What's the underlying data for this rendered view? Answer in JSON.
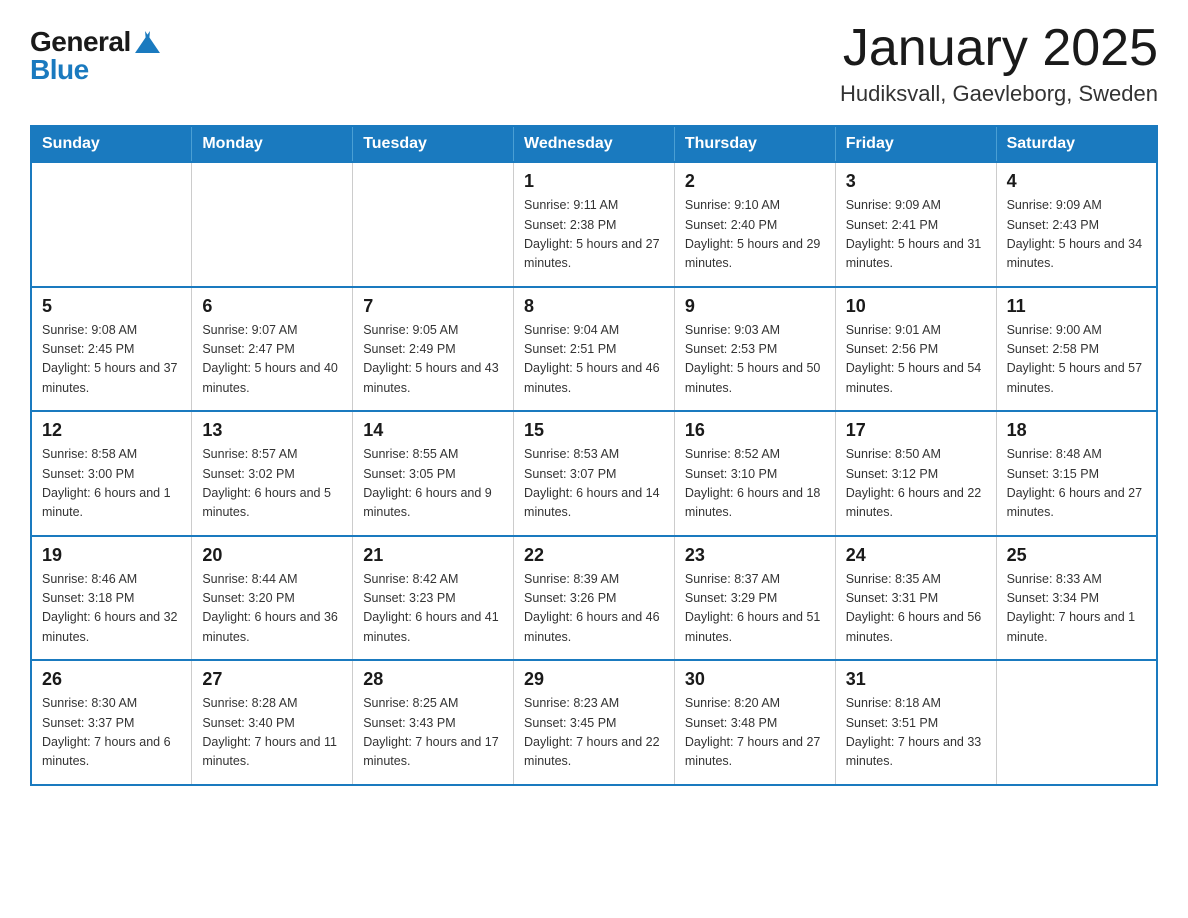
{
  "header": {
    "logo_general": "General",
    "logo_blue": "Blue",
    "month_title": "January 2025",
    "location": "Hudiksvall, Gaevleborg, Sweden"
  },
  "days_of_week": [
    "Sunday",
    "Monday",
    "Tuesday",
    "Wednesday",
    "Thursday",
    "Friday",
    "Saturday"
  ],
  "weeks": [
    [
      {
        "day": "",
        "detail": ""
      },
      {
        "day": "",
        "detail": ""
      },
      {
        "day": "",
        "detail": ""
      },
      {
        "day": "1",
        "detail": "Sunrise: 9:11 AM\nSunset: 2:38 PM\nDaylight: 5 hours\nand 27 minutes."
      },
      {
        "day": "2",
        "detail": "Sunrise: 9:10 AM\nSunset: 2:40 PM\nDaylight: 5 hours\nand 29 minutes."
      },
      {
        "day": "3",
        "detail": "Sunrise: 9:09 AM\nSunset: 2:41 PM\nDaylight: 5 hours\nand 31 minutes."
      },
      {
        "day": "4",
        "detail": "Sunrise: 9:09 AM\nSunset: 2:43 PM\nDaylight: 5 hours\nand 34 minutes."
      }
    ],
    [
      {
        "day": "5",
        "detail": "Sunrise: 9:08 AM\nSunset: 2:45 PM\nDaylight: 5 hours\nand 37 minutes."
      },
      {
        "day": "6",
        "detail": "Sunrise: 9:07 AM\nSunset: 2:47 PM\nDaylight: 5 hours\nand 40 minutes."
      },
      {
        "day": "7",
        "detail": "Sunrise: 9:05 AM\nSunset: 2:49 PM\nDaylight: 5 hours\nand 43 minutes."
      },
      {
        "day": "8",
        "detail": "Sunrise: 9:04 AM\nSunset: 2:51 PM\nDaylight: 5 hours\nand 46 minutes."
      },
      {
        "day": "9",
        "detail": "Sunrise: 9:03 AM\nSunset: 2:53 PM\nDaylight: 5 hours\nand 50 minutes."
      },
      {
        "day": "10",
        "detail": "Sunrise: 9:01 AM\nSunset: 2:56 PM\nDaylight: 5 hours\nand 54 minutes."
      },
      {
        "day": "11",
        "detail": "Sunrise: 9:00 AM\nSunset: 2:58 PM\nDaylight: 5 hours\nand 57 minutes."
      }
    ],
    [
      {
        "day": "12",
        "detail": "Sunrise: 8:58 AM\nSunset: 3:00 PM\nDaylight: 6 hours\nand 1 minute."
      },
      {
        "day": "13",
        "detail": "Sunrise: 8:57 AM\nSunset: 3:02 PM\nDaylight: 6 hours\nand 5 minutes."
      },
      {
        "day": "14",
        "detail": "Sunrise: 8:55 AM\nSunset: 3:05 PM\nDaylight: 6 hours\nand 9 minutes."
      },
      {
        "day": "15",
        "detail": "Sunrise: 8:53 AM\nSunset: 3:07 PM\nDaylight: 6 hours\nand 14 minutes."
      },
      {
        "day": "16",
        "detail": "Sunrise: 8:52 AM\nSunset: 3:10 PM\nDaylight: 6 hours\nand 18 minutes."
      },
      {
        "day": "17",
        "detail": "Sunrise: 8:50 AM\nSunset: 3:12 PM\nDaylight: 6 hours\nand 22 minutes."
      },
      {
        "day": "18",
        "detail": "Sunrise: 8:48 AM\nSunset: 3:15 PM\nDaylight: 6 hours\nand 27 minutes."
      }
    ],
    [
      {
        "day": "19",
        "detail": "Sunrise: 8:46 AM\nSunset: 3:18 PM\nDaylight: 6 hours\nand 32 minutes."
      },
      {
        "day": "20",
        "detail": "Sunrise: 8:44 AM\nSunset: 3:20 PM\nDaylight: 6 hours\nand 36 minutes."
      },
      {
        "day": "21",
        "detail": "Sunrise: 8:42 AM\nSunset: 3:23 PM\nDaylight: 6 hours\nand 41 minutes."
      },
      {
        "day": "22",
        "detail": "Sunrise: 8:39 AM\nSunset: 3:26 PM\nDaylight: 6 hours\nand 46 minutes."
      },
      {
        "day": "23",
        "detail": "Sunrise: 8:37 AM\nSunset: 3:29 PM\nDaylight: 6 hours\nand 51 minutes."
      },
      {
        "day": "24",
        "detail": "Sunrise: 8:35 AM\nSunset: 3:31 PM\nDaylight: 6 hours\nand 56 minutes."
      },
      {
        "day": "25",
        "detail": "Sunrise: 8:33 AM\nSunset: 3:34 PM\nDaylight: 7 hours\nand 1 minute."
      }
    ],
    [
      {
        "day": "26",
        "detail": "Sunrise: 8:30 AM\nSunset: 3:37 PM\nDaylight: 7 hours\nand 6 minutes."
      },
      {
        "day": "27",
        "detail": "Sunrise: 8:28 AM\nSunset: 3:40 PM\nDaylight: 7 hours\nand 11 minutes."
      },
      {
        "day": "28",
        "detail": "Sunrise: 8:25 AM\nSunset: 3:43 PM\nDaylight: 7 hours\nand 17 minutes."
      },
      {
        "day": "29",
        "detail": "Sunrise: 8:23 AM\nSunset: 3:45 PM\nDaylight: 7 hours\nand 22 minutes."
      },
      {
        "day": "30",
        "detail": "Sunrise: 8:20 AM\nSunset: 3:48 PM\nDaylight: 7 hours\nand 27 minutes."
      },
      {
        "day": "31",
        "detail": "Sunrise: 8:18 AM\nSunset: 3:51 PM\nDaylight: 7 hours\nand 33 minutes."
      },
      {
        "day": "",
        "detail": ""
      }
    ]
  ]
}
